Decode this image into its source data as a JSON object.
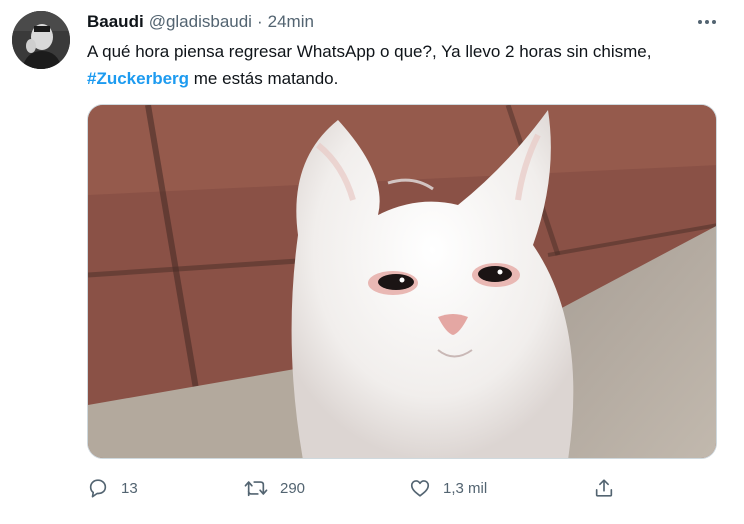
{
  "tweet": {
    "author_name": "Baaudi",
    "handle": "@gladisbaudi",
    "separator": "·",
    "time": "24min",
    "text_before": "A qué hora piensa regresar WhatsApp o que?, Ya llevo 2 horas sin chisme,",
    "hashtag": "#Zuckerberg",
    "text_after": " me estás matando."
  },
  "actions": {
    "reply_count": "13",
    "retweet_count": "290",
    "like_count": "1,3 mil",
    "share_label": ""
  },
  "icons": {
    "more": "more-icon",
    "reply": "reply-icon",
    "retweet": "retweet-icon",
    "like": "heart-icon",
    "share": "share-icon"
  },
  "colors": {
    "link": "#1d9bf0",
    "secondary_text": "#536471",
    "primary_text": "#0f1419"
  }
}
